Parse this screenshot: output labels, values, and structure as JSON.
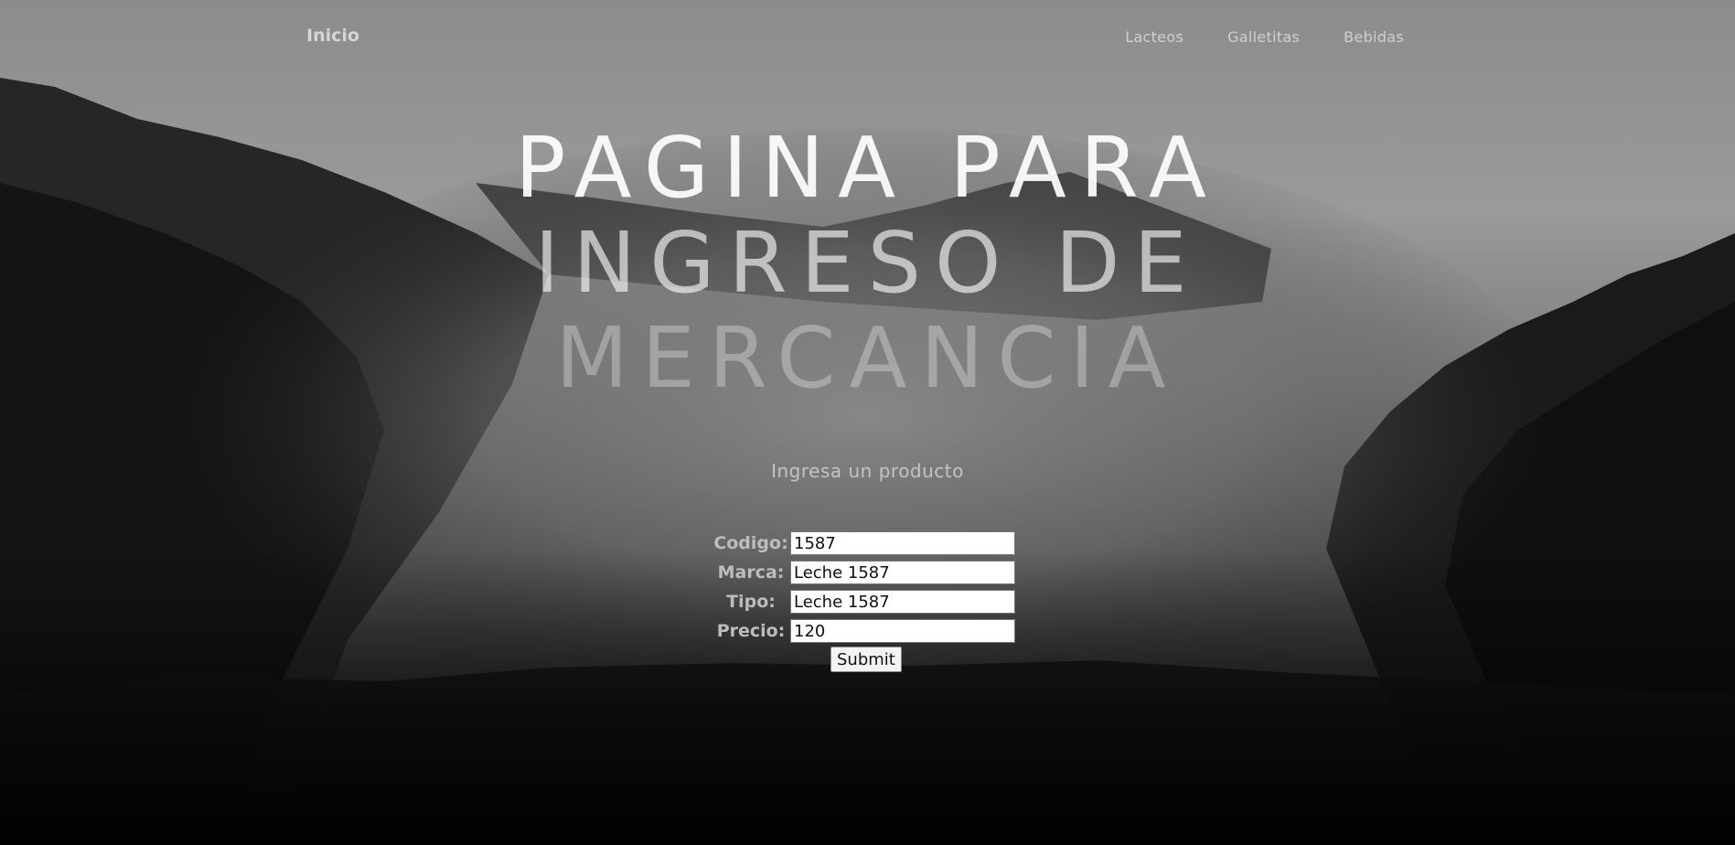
{
  "nav": {
    "brand": "Inicio",
    "links": [
      "Lacteos",
      "Galletitas",
      "Bebidas"
    ]
  },
  "hero": {
    "lines": [
      "PAGINA PARA",
      "INGRESO DE",
      "MERCANCIA"
    ]
  },
  "subtitle": "Ingresa un producto",
  "form": {
    "fields": [
      {
        "label": "Codigo:",
        "value": "1587"
      },
      {
        "label": "Marca:",
        "value": "Leche 1587"
      },
      {
        "label": "Tipo:",
        "value": "Leche 1587"
      },
      {
        "label": "Precio:",
        "value": "120"
      }
    ],
    "submit_label": "Submit"
  },
  "colors": {
    "sky": "#8f8f8f",
    "forest": "#0d0d0d",
    "fog": "#7a7a7a"
  }
}
